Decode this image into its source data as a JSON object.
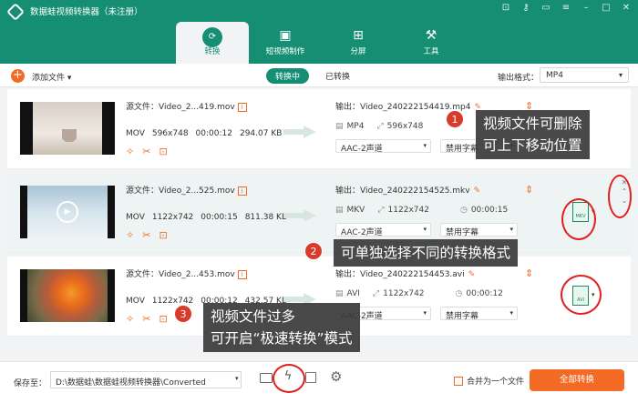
{
  "app": {
    "title": "数据蛙视频转换器（未注册）"
  },
  "tabs": [
    {
      "label": "转换",
      "icon": "convert-icon"
    },
    {
      "label": "短视频制作",
      "icon": "image-icon"
    },
    {
      "label": "分屏",
      "icon": "split-screen-icon"
    },
    {
      "label": "工具",
      "icon": "toolbox-icon"
    }
  ],
  "toolbar": {
    "add_file": "添加文件",
    "seg_converting": "转换中",
    "seg_converted": "已转换",
    "output_format_label": "输出格式：",
    "output_format_value": "MP4"
  },
  "files": [
    {
      "source": "源文件：Video_2...419.mov",
      "format": "MOV",
      "resolution": "596x748",
      "duration": "00:00:12",
      "size": "294.07 KB",
      "output": "输出：Video_240222154419.mp4",
      "out_format": "MP4",
      "out_resolution": "596x748",
      "out_duration": "",
      "audio": "AAC-2声道",
      "subtitle": "禁用字幕"
    },
    {
      "source": "源文件：Video_2...525.mov",
      "format": "MOV",
      "resolution": "1122x742",
      "duration": "00:00:15",
      "size": "811.38 KB",
      "output": "输出：Video_240222154525.mkv",
      "out_format": "MKV",
      "out_resolution": "1122x742",
      "out_duration": "00:00:15",
      "audio": "AAC-2声道",
      "subtitle": "禁用字幕"
    },
    {
      "source": "源文件：Video_2...453.mov",
      "format": "MOV",
      "resolution": "1122x742",
      "duration": "00:00:12",
      "size": "432.57 KB",
      "output": "输出：Video_240222154453.avi",
      "out_format": "AVI",
      "out_resolution": "1122x742",
      "out_duration": "00:00:12",
      "audio": "AAC-2声道",
      "subtitle": "禁用字幕"
    }
  ],
  "bottom": {
    "save_label": "保存至：",
    "save_path": "D:\\数据蛙\\数据蛙视频转换器\\Converted",
    "merge_label": "合并为一个文件",
    "convert_all": "全部转换"
  },
  "annotations": {
    "note1_line1": "视频文件可删除",
    "note1_line2": "可上下移动位置",
    "note2": "可单独选择不同的转换格式",
    "note3_line1": "视频文件过多",
    "note3_line2": "可开启“极速转换”模式",
    "badge1": "1",
    "badge2": "2",
    "badge3": "3"
  },
  "colors": {
    "brand": "#168e74",
    "accent": "#f26a24",
    "annotation": "#e02020"
  }
}
